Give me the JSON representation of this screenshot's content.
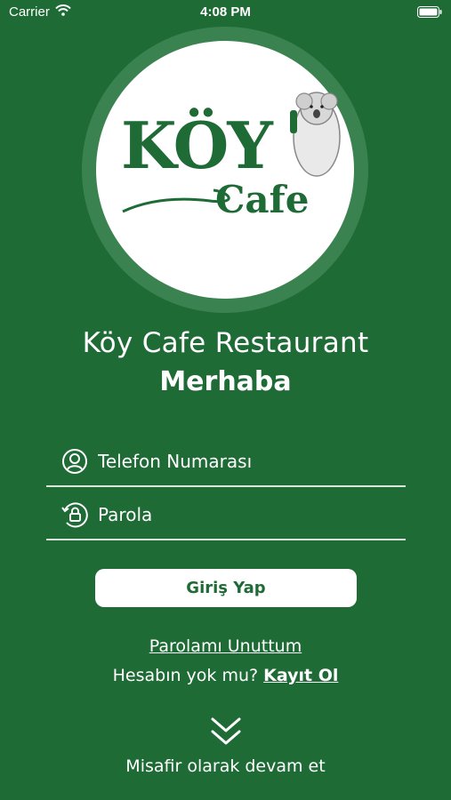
{
  "status_bar": {
    "carrier": "Carrier",
    "time": "4:08 PM",
    "wifi_icon": "wifi-icon",
    "battery_icon": "battery-icon"
  },
  "logo": {
    "brand_top": "KÖY",
    "brand_bottom": "Cafe",
    "mascot_icon": "koala-icon"
  },
  "title": "Köy Cafe Restaurant",
  "subtitle": "Merhaba",
  "form": {
    "phone_placeholder": "Telefon Numarası",
    "phone_icon": "user-icon",
    "password_placeholder": "Parola",
    "password_icon": "lock-icon",
    "login_label": "Giriş Yap"
  },
  "links": {
    "forgot_password": "Parolamı Unuttum",
    "no_account": "Hesabın yok mu?",
    "register": "Kayıt Ol",
    "guest": "Misafir olarak devam et",
    "guest_icon": "double-chevron-down-icon"
  },
  "colors": {
    "background": "#1e6b36",
    "ring": "#3a8350",
    "button": "#ffffff",
    "button_text": "#1e6b36"
  }
}
